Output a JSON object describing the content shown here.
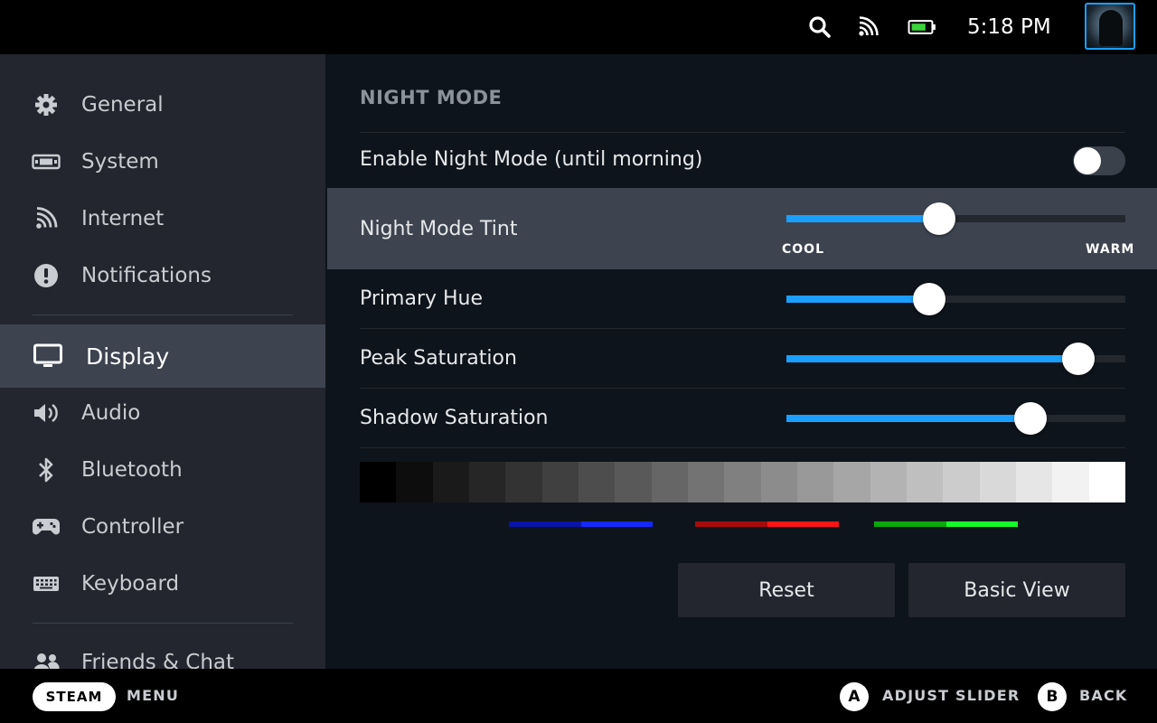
{
  "status_bar": {
    "time": "5:18 PM",
    "icons": [
      "search-icon",
      "wifi-icon",
      "battery-icon"
    ],
    "battery_color": "#3bd23b"
  },
  "sidebar": {
    "items": [
      {
        "label": "General",
        "icon": "gear-icon"
      },
      {
        "label": "System",
        "icon": "system-icon"
      },
      {
        "label": "Internet",
        "icon": "wifi-icon"
      },
      {
        "label": "Notifications",
        "icon": "alert-icon"
      },
      {
        "label": "Display",
        "icon": "monitor-icon",
        "active": true
      },
      {
        "label": "Audio",
        "icon": "speaker-icon"
      },
      {
        "label": "Bluetooth",
        "icon": "bluetooth-icon"
      },
      {
        "label": "Controller",
        "icon": "gamepad-icon"
      },
      {
        "label": "Keyboard",
        "icon": "keyboard-icon"
      },
      {
        "label": "Friends & Chat",
        "icon": "friends-icon"
      }
    ]
  },
  "content": {
    "section_title": "NIGHT MODE",
    "enable_label": "Enable Night Mode (until morning)",
    "enable_value": false,
    "tint": {
      "label": "Night Mode Tint",
      "value": 0.45,
      "min_label": "COOL",
      "max_label": "WARM"
    },
    "primary_hue": {
      "label": "Primary Hue",
      "value": 0.42
    },
    "peak_saturation": {
      "label": "Peak Saturation",
      "value": 0.86
    },
    "shadow_saturation": {
      "label": "Shadow Saturation",
      "value": 0.72
    },
    "color_bars": [
      {
        "name": "blue",
        "dark": "#0a14a8",
        "bright": "#1428ff"
      },
      {
        "name": "red",
        "dark": "#a80a0a",
        "bright": "#ff1414"
      },
      {
        "name": "green",
        "dark": "#0aa80a",
        "bright": "#14ff28"
      }
    ],
    "reset_label": "Reset",
    "basic_view_label": "Basic View"
  },
  "bottom_bar": {
    "steam_label": "STEAM",
    "menu_label": "MENU",
    "a_button": "A",
    "a_label": "ADJUST SLIDER",
    "b_button": "B",
    "b_label": "BACK"
  },
  "accent_color": "#1a9fff"
}
